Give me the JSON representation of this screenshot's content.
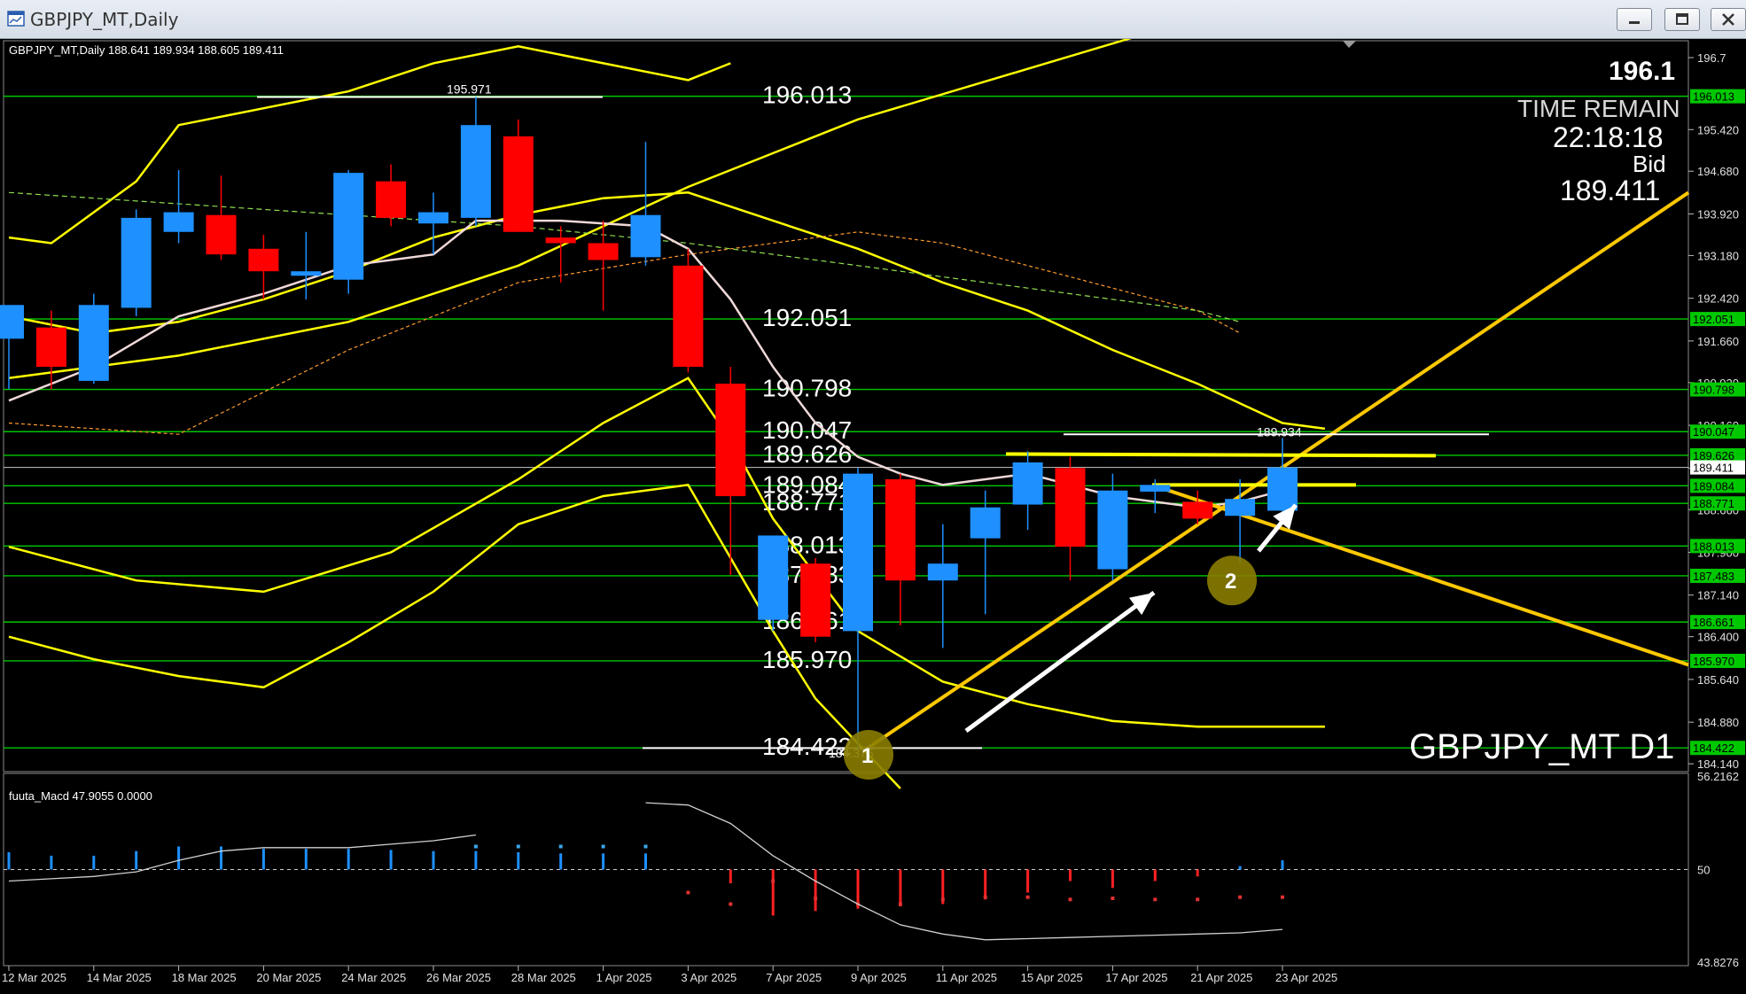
{
  "window": {
    "title": "GBPJPY_MT,Daily",
    "minimize_icon": "minimize-icon",
    "maximize_icon": "maximize-icon",
    "close_icon": "close-icon"
  },
  "chart_data": {
    "type": "candlestick",
    "info_line": "GBPJPY_MT,Daily  188.641 189.934 188.605 189.411",
    "watermark": "GBPJPY_MT D1",
    "overlay": {
      "price_top": "196.1",
      "time_remain_label": "TIME REMAIN",
      "time_remain": "22:18:18",
      "bid_label": "Bid",
      "bid": "189.411"
    },
    "price_axis_ticks": [
      "196.7",
      "195.420",
      "194.680",
      "193.920",
      "193.180",
      "192.420",
      "191.660",
      "190.920",
      "190.160",
      "189.400",
      "188.660",
      "187.900",
      "187.140",
      "186.400",
      "185.640",
      "184.880",
      "184.140"
    ],
    "ylim": [
      184.0,
      197.0
    ],
    "levels": [
      {
        "label": "196.013",
        "value": 196.013
      },
      {
        "label": "192.051",
        "value": 192.051
      },
      {
        "label": "190.798",
        "value": 190.798
      },
      {
        "label": "190.047",
        "value": 190.047
      },
      {
        "label": "189.626",
        "value": 189.626
      },
      {
        "label": "189.084",
        "value": 189.084
      },
      {
        "label": "188.771",
        "value": 188.771
      },
      {
        "label": "188.013",
        "value": 188.013
      },
      {
        "label": "187.483",
        "value": 187.483
      },
      {
        "label": "186.661",
        "value": 186.661
      },
      {
        "label": "185.970",
        "value": 185.97
      },
      {
        "label": "184.422",
        "value": 184.422
      }
    ],
    "current_price": {
      "label": "189.411",
      "value": 189.411
    },
    "markers": {
      "high": {
        "label": "195.971",
        "value": 195.971
      },
      "low": {
        "label": "184.375",
        "value": 184.375
      },
      "last_high": {
        "label": "189.934",
        "value": 189.934
      }
    },
    "circle_labels": [
      "1",
      "2"
    ],
    "date_labels": [
      "12 Mar 2025",
      "14 Mar 2025",
      "18 Mar 2025",
      "20 Mar 2025",
      "24 Mar 2025",
      "26 Mar 2025",
      "28 Mar 2025",
      "1 Apr 2025",
      "3 Apr 2025",
      "7 Apr 2025",
      "9 Apr 2025",
      "11 Apr 2025",
      "15 Apr 2025",
      "17 Apr 2025",
      "21 Apr 2025",
      "23 Apr 2025"
    ],
    "candles": [
      {
        "o": 191.7,
        "h": 192.1,
        "l": 190.8,
        "c": 192.3
      },
      {
        "o": 191.9,
        "h": 192.2,
        "l": 190.8,
        "c": 191.2
      },
      {
        "o": 190.95,
        "h": 192.5,
        "l": 190.9,
        "c": 192.3
      },
      {
        "o": 192.25,
        "h": 194.0,
        "l": 192.1,
        "c": 193.85
      },
      {
        "o": 193.6,
        "h": 194.7,
        "l": 193.4,
        "c": 193.95
      },
      {
        "o": 193.9,
        "h": 194.6,
        "l": 193.1,
        "c": 193.2
      },
      {
        "o": 193.3,
        "h": 193.55,
        "l": 192.4,
        "c": 192.9
      },
      {
        "o": 192.82,
        "h": 193.6,
        "l": 192.4,
        "c": 192.9
      },
      {
        "o": 192.75,
        "h": 194.7,
        "l": 192.5,
        "c": 194.65
      },
      {
        "o": 194.5,
        "h": 194.8,
        "l": 193.7,
        "c": 193.85
      },
      {
        "o": 193.75,
        "h": 194.3,
        "l": 193.2,
        "c": 193.95
      },
      {
        "o": 193.85,
        "h": 196.0,
        "l": 193.7,
        "c": 195.5
      },
      {
        "o": 195.3,
        "h": 195.6,
        "l": 193.6,
        "c": 193.6
      },
      {
        "o": 193.5,
        "h": 193.7,
        "l": 192.7,
        "c": 193.4
      },
      {
        "o": 193.4,
        "h": 193.8,
        "l": 192.2,
        "c": 193.1
      },
      {
        "o": 193.15,
        "h": 195.2,
        "l": 193.0,
        "c": 193.9
      },
      {
        "o": 193.0,
        "h": 193.3,
        "l": 191.1,
        "c": 191.2
      },
      {
        "o": 190.9,
        "h": 191.2,
        "l": 187.5,
        "c": 188.9
      },
      {
        "o": 186.7,
        "h": 188.2,
        "l": 186.5,
        "c": 188.2
      },
      {
        "o": 187.7,
        "h": 187.8,
        "l": 186.3,
        "c": 186.4
      },
      {
        "o": 186.5,
        "h": 189.4,
        "l": 184.375,
        "c": 189.3
      },
      {
        "o": 189.2,
        "h": 189.3,
        "l": 186.6,
        "c": 187.4
      },
      {
        "o": 187.4,
        "h": 188.4,
        "l": 186.2,
        "c": 187.7
      },
      {
        "o": 188.15,
        "h": 189.0,
        "l": 186.8,
        "c": 188.7
      },
      {
        "o": 188.75,
        "h": 189.7,
        "l": 188.3,
        "c": 189.5
      },
      {
        "o": 189.4,
        "h": 189.6,
        "l": 187.4,
        "c": 188.0
      },
      {
        "o": 187.6,
        "h": 189.3,
        "l": 187.4,
        "c": 189.0
      },
      {
        "o": 188.98,
        "h": 189.2,
        "l": 188.6,
        "c": 189.1
      },
      {
        "o": 188.8,
        "h": 189.0,
        "l": 188.4,
        "c": 188.5
      },
      {
        "o": 188.55,
        "h": 189.2,
        "l": 187.7,
        "c": 188.85
      },
      {
        "o": 188.641,
        "h": 189.934,
        "l": 188.605,
        "c": 189.411
      }
    ],
    "macd": {
      "label": "fuuta_Macd 47.9055  0.0000",
      "ticks": [
        "56.2162",
        "50",
        "43.8276"
      ],
      "ylim": [
        43.6,
        56.4
      ],
      "zero": 50,
      "hist": [
        1.5,
        1.2,
        1.2,
        1.6,
        2.0,
        2.0,
        1.8,
        1.8,
        1.8,
        1.7,
        1.6,
        1.6,
        1.5,
        1.4,
        1.4,
        1.4,
        0,
        -1.2,
        -4.0,
        -3.6,
        -3.4,
        -3.2,
        -3.0,
        -2.6,
        -2.0,
        -1.0,
        -1.6,
        -1.0,
        -0.6,
        0.3,
        0.8
      ],
      "signal": [
        null,
        null,
        null,
        null,
        null,
        null,
        null,
        null,
        null,
        null,
        null,
        2.0,
        2.0,
        2.0,
        2.0,
        2.0,
        -2.0,
        -3.0,
        -1.0,
        -2.5,
        -3.0,
        -3.0,
        -2.6,
        -2.4,
        -2.4,
        -2.6,
        -2.5,
        -2.6,
        -2.6,
        -2.4,
        -2.4
      ],
      "line": [
        -1.0,
        -0.8,
        -0.6,
        -0.2,
        0.8,
        1.6,
        1.9,
        1.9,
        1.9,
        2.2,
        2.5,
        3.0,
        null,
        null,
        null,
        5.8,
        5.6,
        4.0,
        1.2,
        -1.0,
        -3.0,
        -4.8,
        -5.6,
        -6.1,
        -6.0,
        -5.9,
        -5.8,
        -5.7,
        -5.6,
        -5.5,
        -5.2
      ]
    },
    "colors": {
      "bull": "#1e90ff",
      "bear": "#ff0000",
      "level": "#00c800",
      "band": "#ffff00",
      "trend": "#ffc800",
      "ma": "#f0d8d8",
      "macd_up": "#1e90ff",
      "macd_down": "#ff2020"
    }
  }
}
